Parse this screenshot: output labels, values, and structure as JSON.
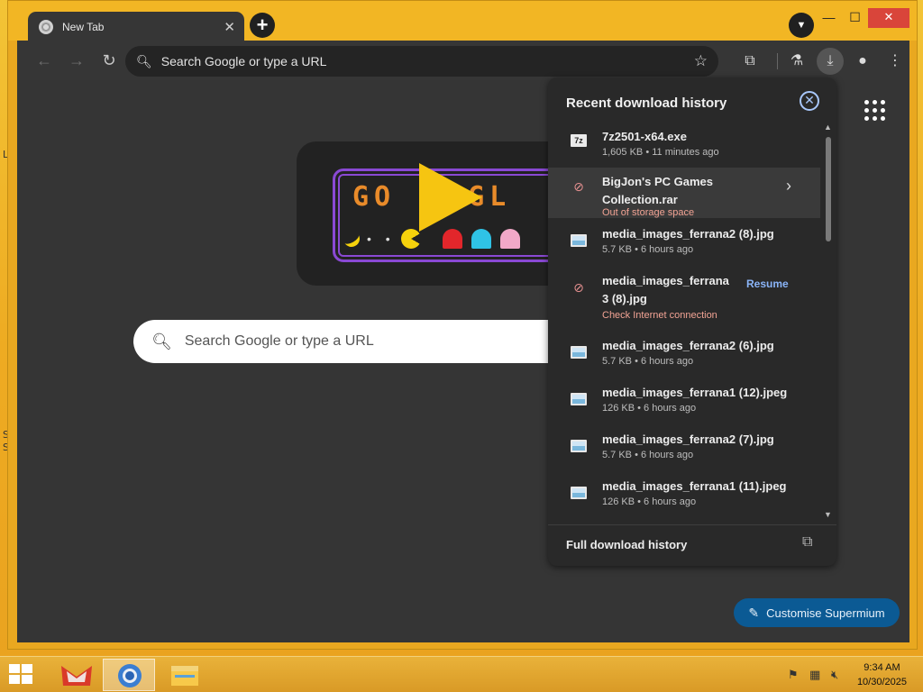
{
  "browser": {
    "tab_title": "New Tab",
    "tab_close": "✕",
    "new_tab": "+",
    "omnibox_placeholder": "Search Google or type a URL"
  },
  "ntp": {
    "search_placeholder": "Search Google or type a URL",
    "doodle_left": "GO",
    "doodle_right": "GL",
    "customise_label": "Customise Supermium"
  },
  "downloads": {
    "title": "Recent download history",
    "items": [
      {
        "name": "7z2501-x64.exe",
        "meta": "1,605 KB • 11 minutes ago",
        "icon": "exe-icon",
        "icon_label": "7z"
      },
      {
        "name_line1": "BigJon's PC Games",
        "name_line2": "Collection.rar",
        "meta": "Out of storage space",
        "icon": "download-failed-icon"
      },
      {
        "name": "media_images_ferrana2 (8).jpg",
        "meta": "5.7 KB • 6 hours ago",
        "icon": "image-file-icon"
      },
      {
        "name_line1": "media_images_ferrana",
        "name_line2": "3 (8).jpg",
        "meta": "Check Internet connection",
        "icon": "download-failed-icon",
        "action": "Resume"
      },
      {
        "name": "media_images_ferrana2 (6).jpg",
        "meta": "5.7 KB • 6 hours ago",
        "icon": "image-file-icon"
      },
      {
        "name": "media_images_ferrana1 (12).jpeg",
        "meta": "126 KB • 6 hours ago",
        "icon": "image-file-icon"
      },
      {
        "name": "media_images_ferrana2 (7).jpg",
        "meta": "5.7 KB • 6 hours ago",
        "icon": "image-file-icon"
      },
      {
        "name": "media_images_ferrana1 (11).jpeg",
        "meta": "126 KB • 6 hours ago",
        "icon": "image-file-icon"
      }
    ],
    "footer_label": "Full download history"
  },
  "taskbar": {
    "time": "9:34 AM",
    "date": "10/30/2025"
  },
  "colors": {
    "accent": "#0b5a94",
    "link": "#8ab4f8",
    "error": "#f2a394",
    "desktop": "#f0b62a"
  }
}
